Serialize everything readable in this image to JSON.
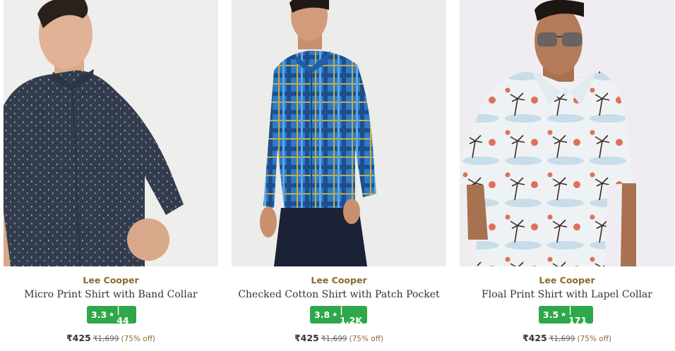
{
  "products": [
    {
      "brand": "Lee Cooper",
      "name": "Micro Print Shirt with Band Collar",
      "rating": "3.3",
      "reviews": "| 44",
      "price": "₹425",
      "mrp": "₹1,699",
      "discount": "(75% off)",
      "image": "model in navy micro-print shirt"
    },
    {
      "brand": "Lee Cooper",
      "name": "Checked Cotton Shirt with Patch Pocket",
      "rating": "3.8",
      "reviews": "| 1.2K",
      "price": "₹425",
      "mrp": "₹1,699",
      "discount": "(75% off)",
      "image": "model in blue checked shirt"
    },
    {
      "brand": "Lee Cooper",
      "name": "Floal Print Shirt with Lapel Collar",
      "rating": "3.5",
      "reviews": "| 171",
      "price": "₹425",
      "mrp": "₹1,699",
      "discount": "(75% off)",
      "image": "model in palm-tree print shirt with sunglasses"
    }
  ],
  "star_glyph": "★",
  "colors": {
    "brand": "#8a6a2f",
    "rating_badge": "#2ea84a",
    "text": "#333333"
  }
}
